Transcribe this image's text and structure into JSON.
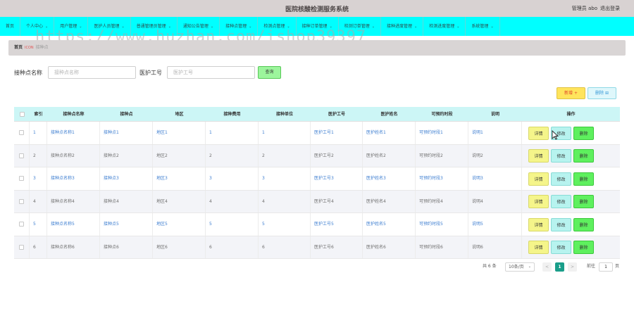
{
  "header": {
    "title": "医院核酸检测服务系统",
    "admin": "管理员 abo",
    "logout": "退出登录"
  },
  "nav": [
    {
      "label": "首页",
      "dropdown": false
    },
    {
      "label": "个人中心",
      "dropdown": true
    },
    {
      "label": "用户管理",
      "dropdown": true
    },
    {
      "label": "医护人员管理",
      "dropdown": true
    },
    {
      "label": "普通管理员管理",
      "dropdown": true
    },
    {
      "label": "通知公告管理",
      "dropdown": true
    },
    {
      "label": "接种点管理",
      "dropdown": true
    },
    {
      "label": "检测点管理",
      "dropdown": true
    },
    {
      "label": "接种订单管理",
      "dropdown": true
    },
    {
      "label": "检测订单管理",
      "dropdown": true
    },
    {
      "label": "接种进度管理",
      "dropdown": true
    },
    {
      "label": "检测进度管理",
      "dropdown": true
    },
    {
      "label": "系统管理",
      "dropdown": true
    }
  ],
  "watermark": "https://www.huzhan.com/ishop39397",
  "breadcrumb": {
    "home": "首页",
    "separator": "ICON",
    "current": "接种点"
  },
  "search": {
    "name_label": "接种点名称",
    "name_placeholder": "接种点名称",
    "staff_label": "医护工号",
    "staff_placeholder": "医护工号",
    "search_button": "查询"
  },
  "actions": {
    "add": "新增 +",
    "delete": "删除 ⊞"
  },
  "table": {
    "headers": [
      "索引",
      "接种点名称",
      "接种点",
      "地区",
      "接种费用",
      "接种单位",
      "医护工号",
      "医护姓名",
      "可预约时段",
      "说明",
      "操作"
    ],
    "rows": [
      [
        "1",
        "接种点名称1",
        "接种点1",
        "地区1",
        "1",
        "1",
        "医护工号1",
        "医护姓名1",
        "可预约时段1",
        "说明1"
      ],
      [
        "2",
        "接种点名称2",
        "接种点2",
        "地区2",
        "2",
        "2",
        "医护工号2",
        "医护姓名2",
        "可预约时段2",
        "说明2"
      ],
      [
        "3",
        "接种点名称3",
        "接种点3",
        "地区3",
        "3",
        "3",
        "医护工号3",
        "医护姓名3",
        "可预约时段3",
        "说明3"
      ],
      [
        "4",
        "接种点名称4",
        "接种点4",
        "地区4",
        "4",
        "4",
        "医护工号4",
        "医护姓名4",
        "可预约时段4",
        "说明4"
      ],
      [
        "5",
        "接种点名称5",
        "接种点5",
        "地区5",
        "5",
        "5",
        "医护工号5",
        "医护姓名5",
        "可预约时段5",
        "说明5"
      ],
      [
        "6",
        "接种点名称6",
        "接种点6",
        "地区6",
        "6",
        "6",
        "医护工号6",
        "医护姓名6",
        "可预约时段6",
        "说明6"
      ]
    ],
    "row_text_colors": [
      "blue",
      "gray",
      "blue",
      "gray",
      "blue",
      "gray"
    ],
    "op_labels": {
      "detail": "详情",
      "edit": "修改",
      "remove": "删除"
    }
  },
  "pagination": {
    "total": "共 6 条",
    "page_size": "10条/页",
    "prev": "<",
    "current": "1",
    "next": ">",
    "goto_label": "前往",
    "goto_value": "1",
    "page_unit": "页"
  },
  "colors": {
    "nav_bg": "#00ffff",
    "header_bg": "#d8d2d2",
    "table_head_bg": "#ccf6f6",
    "link_blue": "#3f7fd1",
    "pager_active": "#1a9e8a"
  }
}
